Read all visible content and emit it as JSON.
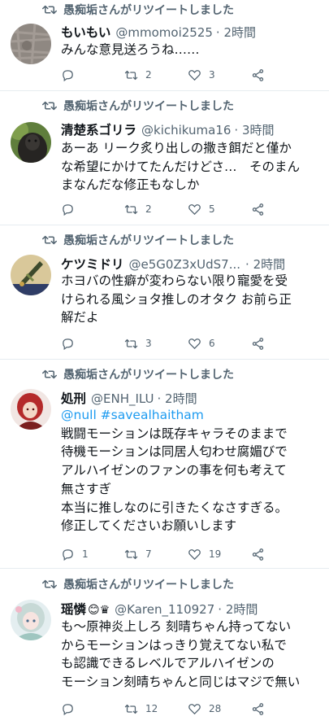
{
  "tweets": [
    {
      "retweeted_by": "愚痴垢さんがリツイートしました",
      "name": "もいもい",
      "handle": "@mmomoi2525",
      "time": "· 2時間",
      "badges": "",
      "lines": [
        "みんな意見送ろうね……"
      ],
      "link_line": "",
      "counts": {
        "reply": "",
        "retweet": "2",
        "like": "3"
      },
      "avatar": "gray-texture"
    },
    {
      "retweeted_by": "愚痴垢さんがリツイートしました",
      "name": "清楚系ゴリラ",
      "handle": "@kichikuma16",
      "time": "· 3時間",
      "badges": "",
      "lines": [
        "あーあ リーク炙り出しの撒き餌だと僅か",
        "な希望にかけてたんだけどさ…　そのまん",
        "まなんだな修正もなしか"
      ],
      "link_line": "",
      "counts": {
        "reply": "",
        "retweet": "2",
        "like": "5"
      },
      "avatar": "gorilla"
    },
    {
      "retweeted_by": "愚痴垢さんがリツイートしました",
      "name": "ケツミドリ",
      "handle": "@e5G0Z3xUdS7...",
      "time": "· 2時間",
      "badges": "",
      "lines": [
        "ホヨバの性癖が変わらない限り寵愛を受",
        "けられる風ショタ推しのオタク お前ら正",
        "解だよ"
      ],
      "link_line": "",
      "counts": {
        "reply": "",
        "retweet": "3",
        "like": "6"
      },
      "avatar": "sword-badge"
    },
    {
      "retweeted_by": "愚痴垢さんがリツイートしました",
      "name": "処刑",
      "handle": "@ENH_ILU",
      "time": "· 2時間",
      "badges": "",
      "link_line": "@null #savealhaitham",
      "lines": [
        "戦闘モーションは既存キャラそのままで",
        "待機モーションは同居人匂わせ腐媚びで",
        "アルハイゼンのファンの事を何も考えて",
        "無さすぎ",
        "本当に推しなのに引きたくなさすぎる。",
        "修正してくださいお願いします"
      ],
      "counts": {
        "reply": "1",
        "retweet": "7",
        "like": "19"
      },
      "avatar": "red-character"
    },
    {
      "retweeted_by": "愚痴垢さんがリツイートしました",
      "name": "瑶憐",
      "handle": "@Karen_110927",
      "time": "· 2時間",
      "badges": "😊♛",
      "lines": [
        "も～原神炎上しろ 刻晴ちゃん持ってない",
        "からモーションはっきり覚えてない私で",
        "も認識できるレベルでアルハイゼンの",
        "モーション刻晴ちゃんと同じはマジで無い"
      ],
      "link_line": "",
      "counts": {
        "reply": "",
        "retweet": "12",
        "like": "28"
      },
      "avatar": "pastel-character"
    }
  ],
  "colors": {
    "text": "#0f1419",
    "muted": "#536471",
    "link": "#1d9bf0",
    "divider": "#e6ecf0"
  }
}
